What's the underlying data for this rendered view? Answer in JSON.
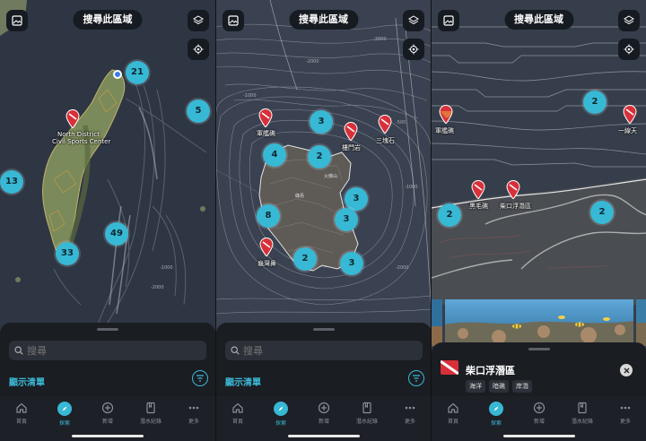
{
  "common": {
    "search_area_label": "搜尋此區域",
    "tabs": [
      "首頁",
      "探索",
      "新增",
      "潛水紀錄",
      "更多"
    ]
  },
  "screen1": {
    "clusters": [
      "21",
      "5",
      "13",
      "49",
      "33"
    ],
    "labels": [
      "North District",
      "Civil Sports Center"
    ],
    "search_placeholder": "搜尋",
    "show_list": "顯示清單"
  },
  "screen2": {
    "clusters": [
      "3",
      "4",
      "2",
      "3",
      "8",
      "3",
      "2",
      "3"
    ],
    "pin_labels": [
      "軍艦礁",
      "樓門岩",
      "三塊石",
      "龜灣鼻"
    ],
    "contour_labels": [
      "-2000",
      "-1000",
      "-500",
      "-1000",
      "-2000",
      "-3000"
    ],
    "search_placeholder": "搜尋",
    "show_list": "顯示清單"
  },
  "screen3": {
    "clusters": [
      "2",
      "2",
      "2"
    ],
    "pin_labels": [
      "軍艦礁",
      "黑毛礁",
      "柴口浮潛區",
      "一線天"
    ],
    "detail": {
      "title": "柴口浮潛區",
      "tags": [
        "海洋",
        "暗礁",
        "岸潛"
      ]
    }
  },
  "colors": {
    "accent": "#37b8d4",
    "sheet": "#1a1d22",
    "map": "#2e3644",
    "pin_red": "#d8303a"
  }
}
